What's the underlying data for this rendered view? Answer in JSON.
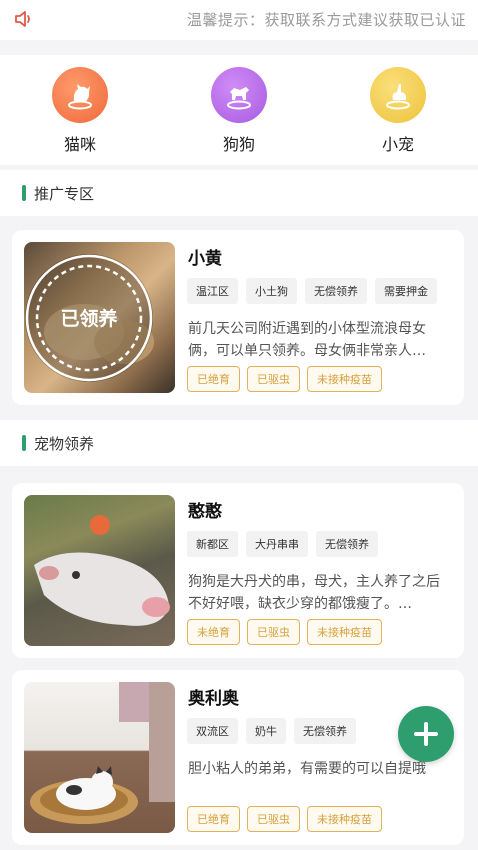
{
  "notice": {
    "text": "温馨提示：获取联系方式建议获取已认证",
    "icon": "speaker-icon"
  },
  "categories": [
    {
      "label": "猫咪",
      "icon": "cat-icon",
      "color": "#f27a4a"
    },
    {
      "label": "狗狗",
      "icon": "dog-icon",
      "color": "#b86ae8"
    },
    {
      "label": "小宠",
      "icon": "rabbit-icon",
      "color": "#f2c84a"
    }
  ],
  "sections": {
    "promo_title": "推广专区",
    "adopt_title": "宠物领养"
  },
  "promo_pet": {
    "name": "小黄",
    "stamp": "已领养",
    "tags": [
      "温江区",
      "小土狗",
      "无偿领养",
      "需要押金"
    ],
    "desc": "前几天公司附近遇到的小体型流浪母女俩，可以单只领养。母女俩非常亲人…",
    "badges": [
      "已绝育",
      "已驱虫",
      "未接种疫苗"
    ]
  },
  "pets": [
    {
      "name": "憨憨",
      "tags": [
        "新都区",
        "大丹串串",
        "无偿领养"
      ],
      "desc": "狗狗是大丹犬的串，母犬，主人养了之后不好好喂，缺衣少穿的都饿瘦了。…",
      "badges": [
        "未绝育",
        "已驱虫",
        "未接种疫苗"
      ]
    },
    {
      "name": "奥利奥",
      "tags": [
        "双流区",
        "奶牛",
        "无偿领养"
      ],
      "desc": "胆小粘人的弟弟，有需要的可以自提哦",
      "badges": [
        "已绝育",
        "已驱虫",
        "未接种疫苗"
      ]
    }
  ],
  "colors": {
    "accent": "#2e9e6e",
    "badge": "#d6a13d"
  }
}
